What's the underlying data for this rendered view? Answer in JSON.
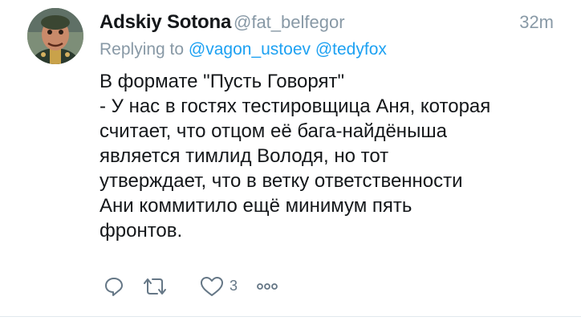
{
  "tweet": {
    "author_name": "Adskiy Sotona",
    "author_handle": "@fat_belfegor",
    "time": "32m",
    "replying_prefix": "Replying to",
    "reply_to": [
      "@vagon_ustoev",
      "@tedyfox"
    ],
    "text_lines": [
      "В формате \"Пусть Говорят\"",
      "- У нас в гостях тестировщица Аня, которая",
      "считает, что отцом её бага-найдёныша",
      "является тимлид Володя, но тот",
      "утверждает, что в ветку ответственности",
      "Ани коммитило ещё минимум пять",
      "фронтов."
    ]
  },
  "actions": {
    "reply_icon": "reply-icon",
    "retweet_icon": "retweet-icon",
    "like_icon": "like-icon",
    "like_count": "3",
    "more_icon": "more-icon"
  },
  "colors": {
    "text": "#14171a",
    "muted": "#8899a6",
    "link": "#1da1f2",
    "icon": "#657786",
    "divider": "#e1e8ed"
  }
}
